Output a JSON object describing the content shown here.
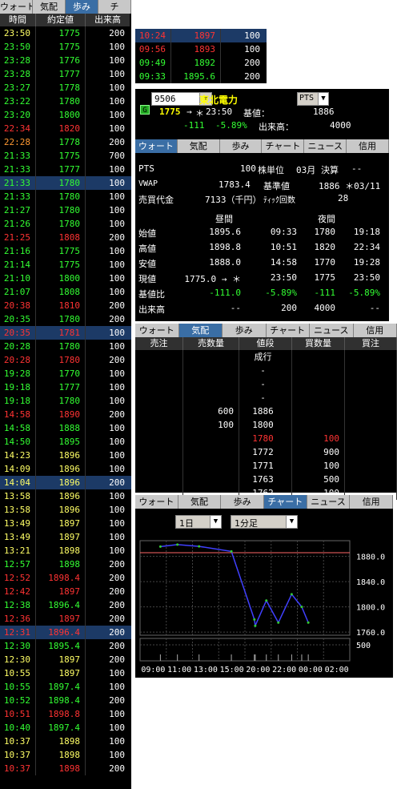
{
  "left": {
    "tabs": [
      "ウォート",
      "気配",
      "歩み",
      "チ"
    ],
    "active_tab": 2,
    "headers": [
      "時間",
      "約定値",
      "出来高"
    ],
    "rows": [
      {
        "t": "23:50",
        "p": "1775",
        "v": "200",
        "tc": "y",
        "pc": "g",
        "vc": "w",
        "sel": false
      },
      {
        "t": "23:50",
        "p": "1775",
        "v": "100",
        "tc": "g",
        "pc": "g",
        "vc": "w",
        "sel": false
      },
      {
        "t": "23:28",
        "p": "1776",
        "v": "100",
        "tc": "g",
        "pc": "g",
        "vc": "w",
        "sel": false
      },
      {
        "t": "23:28",
        "p": "1777",
        "v": "100",
        "tc": "g",
        "pc": "g",
        "vc": "w",
        "sel": false
      },
      {
        "t": "23:27",
        "p": "1778",
        "v": "100",
        "tc": "g",
        "pc": "g",
        "vc": "w",
        "sel": false
      },
      {
        "t": "23:22",
        "p": "1780",
        "v": "100",
        "tc": "g",
        "pc": "g",
        "vc": "w",
        "sel": false
      },
      {
        "t": "23:20",
        "p": "1800",
        "v": "100",
        "tc": "g",
        "pc": "g",
        "vc": "w",
        "sel": false
      },
      {
        "t": "22:34",
        "p": "1820",
        "v": "100",
        "tc": "r",
        "pc": "r",
        "vc": "w",
        "sel": false
      },
      {
        "t": "22:28",
        "p": "1778",
        "v": "200",
        "tc": "o",
        "pc": "g",
        "vc": "w",
        "sel": false
      },
      {
        "t": "21:33",
        "p": "1775",
        "v": "700",
        "tc": "g",
        "pc": "g",
        "vc": "w",
        "sel": false
      },
      {
        "t": "21:33",
        "p": "1777",
        "v": "100",
        "tc": "g",
        "pc": "g",
        "vc": "w",
        "sel": false
      },
      {
        "t": "21:33",
        "p": "1780",
        "v": "100",
        "tc": "g",
        "pc": "g",
        "vc": "w",
        "sel": true
      },
      {
        "t": "21:33",
        "p": "1780",
        "v": "100",
        "tc": "g",
        "pc": "g",
        "vc": "w",
        "sel": false
      },
      {
        "t": "21:27",
        "p": "1780",
        "v": "100",
        "tc": "g",
        "pc": "g",
        "vc": "w",
        "sel": false
      },
      {
        "t": "21:26",
        "p": "1780",
        "v": "100",
        "tc": "g",
        "pc": "g",
        "vc": "w",
        "sel": false
      },
      {
        "t": "21:25",
        "p": "1808",
        "v": "200",
        "tc": "r",
        "pc": "r",
        "vc": "w",
        "sel": false
      },
      {
        "t": "21:16",
        "p": "1775",
        "v": "100",
        "tc": "g",
        "pc": "g",
        "vc": "w",
        "sel": false
      },
      {
        "t": "21:14",
        "p": "1775",
        "v": "100",
        "tc": "g",
        "pc": "g",
        "vc": "w",
        "sel": false
      },
      {
        "t": "21:10",
        "p": "1800",
        "v": "100",
        "tc": "g",
        "pc": "g",
        "vc": "w",
        "sel": false
      },
      {
        "t": "21:07",
        "p": "1808",
        "v": "100",
        "tc": "g",
        "pc": "g",
        "vc": "w",
        "sel": false
      },
      {
        "t": "20:38",
        "p": "1810",
        "v": "200",
        "tc": "r",
        "pc": "r",
        "vc": "w",
        "sel": false
      },
      {
        "t": "20:35",
        "p": "1780",
        "v": "200",
        "tc": "g",
        "pc": "g",
        "vc": "w",
        "sel": false
      },
      {
        "t": "20:35",
        "p": "1781",
        "v": "100",
        "tc": "r",
        "pc": "r",
        "vc": "w",
        "sel": true
      },
      {
        "t": "20:28",
        "p": "1780",
        "v": "100",
        "tc": "g",
        "pc": "g",
        "vc": "w",
        "sel": false
      },
      {
        "t": "20:28",
        "p": "1780",
        "v": "200",
        "tc": "r",
        "pc": "r",
        "vc": "w",
        "sel": false
      },
      {
        "t": "19:28",
        "p": "1770",
        "v": "100",
        "tc": "g",
        "pc": "g",
        "vc": "w",
        "sel": false
      },
      {
        "t": "19:18",
        "p": "1777",
        "v": "100",
        "tc": "g",
        "pc": "g",
        "vc": "w",
        "sel": false
      },
      {
        "t": "19:18",
        "p": "1780",
        "v": "100",
        "tc": "g",
        "pc": "g",
        "vc": "w",
        "sel": false
      },
      {
        "t": "14:58",
        "p": "1890",
        "v": "200",
        "tc": "r",
        "pc": "r",
        "vc": "w",
        "sel": false
      },
      {
        "t": "14:58",
        "p": "1888",
        "v": "100",
        "tc": "g",
        "pc": "g",
        "vc": "w",
        "sel": false
      },
      {
        "t": "14:50",
        "p": "1895",
        "v": "100",
        "tc": "g",
        "pc": "g",
        "vc": "w",
        "sel": false
      },
      {
        "t": "14:23",
        "p": "1896",
        "v": "100",
        "tc": "y",
        "pc": "y",
        "vc": "w",
        "sel": false
      },
      {
        "t": "14:09",
        "p": "1896",
        "v": "100",
        "tc": "y",
        "pc": "y",
        "vc": "w",
        "sel": false
      },
      {
        "t": "14:04",
        "p": "1896",
        "v": "200",
        "tc": "y",
        "pc": "y",
        "vc": "w",
        "sel": true
      },
      {
        "t": "13:58",
        "p": "1896",
        "v": "100",
        "tc": "y",
        "pc": "y",
        "vc": "w",
        "sel": false
      },
      {
        "t": "13:58",
        "p": "1896",
        "v": "100",
        "tc": "y",
        "pc": "y",
        "vc": "w",
        "sel": false
      },
      {
        "t": "13:49",
        "p": "1897",
        "v": "100",
        "tc": "y",
        "pc": "y",
        "vc": "w",
        "sel": false
      },
      {
        "t": "13:49",
        "p": "1897",
        "v": "100",
        "tc": "y",
        "pc": "y",
        "vc": "w",
        "sel": false
      },
      {
        "t": "13:21",
        "p": "1898",
        "v": "100",
        "tc": "y",
        "pc": "y",
        "vc": "w",
        "sel": false
      },
      {
        "t": "12:57",
        "p": "1898",
        "v": "200",
        "tc": "g",
        "pc": "g",
        "vc": "w",
        "sel": false
      },
      {
        "t": "12:52",
        "p": "1898.4",
        "v": "200",
        "tc": "r",
        "pc": "r",
        "vc": "w",
        "sel": false
      },
      {
        "t": "12:42",
        "p": "1897",
        "v": "200",
        "tc": "r",
        "pc": "r",
        "vc": "w",
        "sel": false
      },
      {
        "t": "12:38",
        "p": "1896.4",
        "v": "200",
        "tc": "g",
        "pc": "g",
        "vc": "w",
        "sel": false
      },
      {
        "t": "12:36",
        "p": "1897",
        "v": "200",
        "tc": "r",
        "pc": "r",
        "vc": "w",
        "sel": false
      },
      {
        "t": "12:31",
        "p": "1896.4",
        "v": "200",
        "tc": "r",
        "pc": "r",
        "vc": "w",
        "sel": true
      },
      {
        "t": "12:30",
        "p": "1895.4",
        "v": "200",
        "tc": "g",
        "pc": "g",
        "vc": "w",
        "sel": false
      },
      {
        "t": "12:30",
        "p": "1897",
        "v": "200",
        "tc": "y",
        "pc": "y",
        "vc": "w",
        "sel": false
      },
      {
        "t": "10:55",
        "p": "1897",
        "v": "100",
        "tc": "y",
        "pc": "y",
        "vc": "w",
        "sel": false
      },
      {
        "t": "10:55",
        "p": "1897.4",
        "v": "100",
        "tc": "g",
        "pc": "g",
        "vc": "w",
        "sel": false
      },
      {
        "t": "10:52",
        "p": "1898.4",
        "v": "200",
        "tc": "g",
        "pc": "g",
        "vc": "w",
        "sel": false
      },
      {
        "t": "10:51",
        "p": "1898.8",
        "v": "100",
        "tc": "r",
        "pc": "r",
        "vc": "w",
        "sel": false
      },
      {
        "t": "10:40",
        "p": "1897.4",
        "v": "100",
        "tc": "g",
        "pc": "g",
        "vc": "w",
        "sel": false
      },
      {
        "t": "10:37",
        "p": "1898",
        "v": "100",
        "tc": "y",
        "pc": "y",
        "vc": "w",
        "sel": false
      },
      {
        "t": "10:37",
        "p": "1898",
        "v": "100",
        "tc": "y",
        "pc": "y",
        "vc": "w",
        "sel": false
      },
      {
        "t": "10:37",
        "p": "1898",
        "v": "200",
        "tc": "r",
        "pc": "r",
        "vc": "w",
        "sel": false
      }
    ]
  },
  "mini": {
    "rows": [
      {
        "t": "10:24",
        "p": "1897",
        "v": "100",
        "c": "r",
        "sel": true
      },
      {
        "t": "09:56",
        "p": "1893",
        "v": "100",
        "c": "r",
        "sel": false
      },
      {
        "t": "09:49",
        "p": "1892",
        "v": "200",
        "c": "g",
        "sel": false
      },
      {
        "t": "09:33",
        "p": "1895.6",
        "v": "200",
        "c": "g",
        "sel": false
      }
    ]
  },
  "quote": {
    "code": "9506",
    "name": "東北電力",
    "market": "PTS",
    "badge": "G",
    "price": "1775",
    "arrow": "→",
    "star": "＊",
    "time": "23:50",
    "base_label": "基値：",
    "base_value": "1886",
    "change": "-111",
    "change_pct": "-5.89%",
    "volume_label": "出来高：",
    "volume": "4000",
    "tabs": [
      "ウォート",
      "気配",
      "歩み",
      "チャート",
      "ニュース",
      "信用"
    ],
    "active_tab": 0,
    "pts_label": "PTS",
    "unit_value": "100",
    "unit_label": "株単位",
    "settle_month": "03月",
    "settle_label": "決算",
    "settle_value": "--",
    "vwap_label": "VWAP",
    "vwap_value": "1783.4",
    "std_label": "基準値",
    "std_value": "1886 ＊03/11",
    "turnover_label": "売買代金",
    "turnover_value": "7133（千円）",
    "tick_label": "ﾃｨｯｸ回数",
    "tick_value": "28",
    "day_label": "昼間",
    "night_label": "夜間",
    "table": [
      {
        "label": "始値",
        "dv": "1895.6",
        "dt": "09:33",
        "nv": "1780",
        "nt": "19:18",
        "dvc": "w",
        "nvc": "w"
      },
      {
        "label": "高値",
        "dv": "1898.8",
        "dt": "10:51",
        "nv": "1820",
        "nt": "22:34",
        "dvc": "w",
        "nvc": "w"
      },
      {
        "label": "安値",
        "dv": "1888.0",
        "dt": "14:58",
        "nv": "1770",
        "nt": "19:28",
        "dvc": "w",
        "nvc": "w"
      },
      {
        "label": "現値",
        "dv": "1775.0 → ＊",
        "dt": "23:50",
        "nv": "1775",
        "nt": "23:50",
        "dvc": "w",
        "nvc": "w"
      },
      {
        "label": "基値比",
        "dv": "-111.0",
        "dt": "-5.89%",
        "nv": "-111",
        "nt": "-5.89%",
        "dvc": "g",
        "nvc": "g"
      },
      {
        "label": "出来高",
        "dv": "--",
        "dt": "200",
        "nv": "4000",
        "nt": "--",
        "dvc": "w",
        "nvc": "w"
      }
    ]
  },
  "board": {
    "tabs": [
      "ウォート",
      "気配",
      "歩み",
      "チャート",
      "ニュース",
      "信用"
    ],
    "active_tab": 1,
    "headers": [
      "売注",
      "売数量",
      "値段",
      "買数量",
      "買注"
    ],
    "rows": [
      {
        "sv": "",
        "price": "成行",
        "bv": "",
        "pc": "w"
      },
      {
        "sv": "",
        "price": "-",
        "bv": "",
        "pc": "w"
      },
      {
        "sv": "",
        "price": "-",
        "bv": "",
        "pc": "w"
      },
      {
        "sv": "",
        "price": "-",
        "bv": "",
        "pc": "w"
      },
      {
        "sv": "600",
        "price": "1886",
        "bv": "",
        "pc": "w"
      },
      {
        "sv": "100",
        "price": "1800",
        "bv": "",
        "pc": "w"
      },
      {
        "sv": "",
        "price": "1780",
        "bv": "100",
        "pc": "r"
      },
      {
        "sv": "",
        "price": "1772",
        "bv": "900",
        "pc": "w"
      },
      {
        "sv": "",
        "price": "1771",
        "bv": "100",
        "pc": "w"
      },
      {
        "sv": "",
        "price": "1763",
        "bv": "500",
        "pc": "w"
      },
      {
        "sv": "",
        "price": "1762",
        "bv": "100",
        "pc": "w"
      }
    ]
  },
  "chart": {
    "tabs": [
      "ウォート",
      "気配",
      "歩み",
      "チャート",
      "ニュース",
      "信用"
    ],
    "active_tab": 3,
    "period": "1日",
    "interval": "1分足",
    "y_ticks": [
      "1880.0",
      "1840.0",
      "1800.0",
      "1760.0"
    ],
    "vol_tick": "500",
    "x_ticks": [
      "09:00",
      "11:00",
      "13:00",
      "15:00",
      "20:00",
      "22:00",
      "00:00",
      "02:00"
    ]
  },
  "chart_data": {
    "type": "line",
    "x": [
      "09:33",
      "10:51",
      "12:30",
      "14:58",
      "19:18",
      "19:28",
      "20:38",
      "21:33",
      "22:34",
      "23:20",
      "23:50"
    ],
    "series": [
      {
        "values": [
          1895.6,
          1898.8,
          1896,
          1888,
          1780,
          1770,
          1810,
          1775,
          1820,
          1800,
          1775
        ]
      }
    ],
    "reference_lines": [
      1886
    ],
    "ylim": [
      1755,
      1905
    ],
    "y_ticks": [
      1880,
      1840,
      1800,
      1760
    ],
    "volume_tick": 500,
    "x_ticks": [
      "09:00",
      "11:00",
      "13:00",
      "15:00",
      "20:00",
      "22:00",
      "00:00",
      "02:00"
    ],
    "line_colors": [
      "#4040ff",
      "#33cc33",
      "#cccccc"
    ],
    "ref_color": "#ff6666"
  }
}
